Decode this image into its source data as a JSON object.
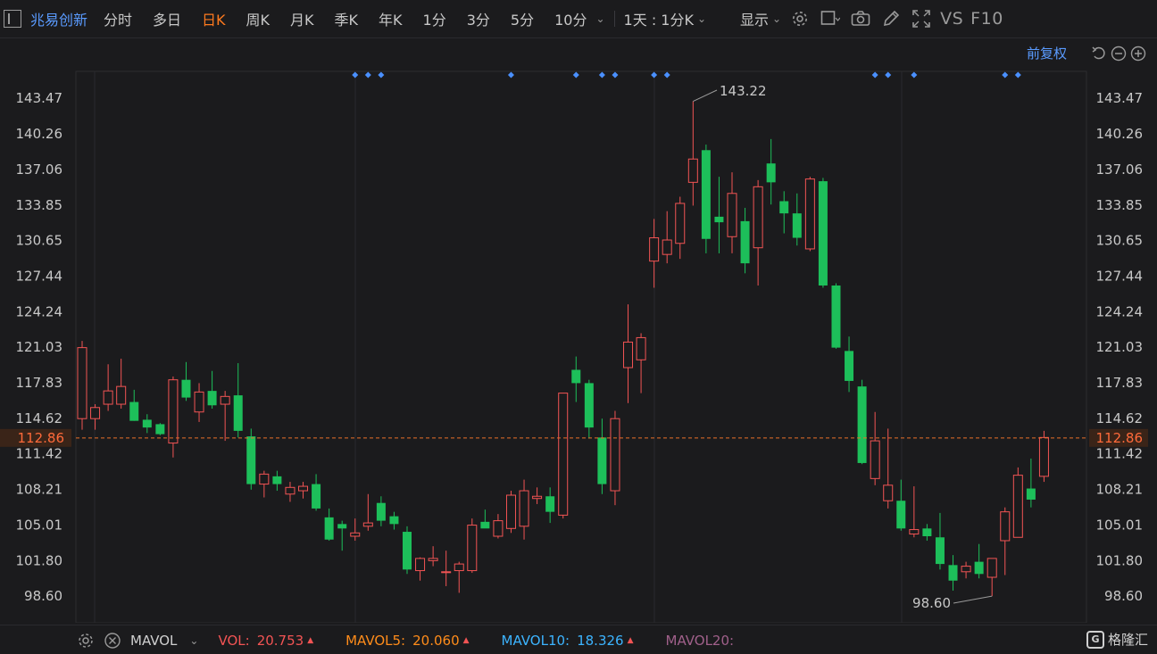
{
  "toolbar": {
    "stock_name": "兆易创新",
    "periods": [
      "分时",
      "多日",
      "日K",
      "周K",
      "月K",
      "季K",
      "年K",
      "1分",
      "3分",
      "5分",
      "10分"
    ],
    "active_period": "日K",
    "multi_period": "1天 : 1分K",
    "display_label": "显示",
    "vs_label": "VS",
    "f10_label": "F10"
  },
  "chart": {
    "restore_label": "前复权",
    "high_label": "143.22",
    "low_label": "98.60",
    "current_price": "112.86",
    "y_ticks": [
      "143.47",
      "140.26",
      "137.06",
      "133.85",
      "130.65",
      "127.44",
      "124.24",
      "121.03",
      "117.83",
      "114.62",
      "111.42",
      "108.21",
      "105.01",
      "101.80",
      "98.60"
    ]
  },
  "chart_data": {
    "type": "candlestick",
    "ylim": [
      96.2,
      145.9
    ],
    "up_color": "#f25454",
    "down_color": "#1dbf5a",
    "candles": [
      {
        "o": 114.6,
        "h": 121.6,
        "l": 113.6,
        "c": 121.0
      },
      {
        "o": 114.6,
        "h": 115.9,
        "l": 113.6,
        "c": 115.6
      },
      {
        "o": 115.9,
        "h": 119.5,
        "l": 115.3,
        "c": 117.1
      },
      {
        "o": 115.9,
        "h": 120.0,
        "l": 115.5,
        "c": 117.5
      },
      {
        "o": 116.1,
        "h": 117.2,
        "l": 114.4,
        "c": 114.4
      },
      {
        "o": 114.5,
        "h": 115.0,
        "l": 113.3,
        "c": 113.8
      },
      {
        "o": 114.1,
        "h": 114.2,
        "l": 113.1,
        "c": 113.2
      },
      {
        "o": 112.4,
        "h": 118.4,
        "l": 111.1,
        "c": 118.1
      },
      {
        "o": 118.1,
        "h": 119.7,
        "l": 116.2,
        "c": 116.5
      },
      {
        "o": 115.2,
        "h": 117.8,
        "l": 114.3,
        "c": 117.0
      },
      {
        "o": 117.1,
        "h": 118.9,
        "l": 115.5,
        "c": 115.8
      },
      {
        "o": 115.9,
        "h": 117.1,
        "l": 112.6,
        "c": 116.6
      },
      {
        "o": 116.7,
        "h": 119.6,
        "l": 112.9,
        "c": 113.5
      },
      {
        "o": 113.0,
        "h": 113.7,
        "l": 108.2,
        "c": 108.7
      },
      {
        "o": 108.7,
        "h": 109.9,
        "l": 107.5,
        "c": 109.6
      },
      {
        "o": 109.4,
        "h": 109.9,
        "l": 108.1,
        "c": 108.7
      },
      {
        "o": 107.8,
        "h": 108.9,
        "l": 107.1,
        "c": 108.4
      },
      {
        "o": 108.1,
        "h": 108.9,
        "l": 107.4,
        "c": 108.5
      },
      {
        "o": 108.7,
        "h": 109.6,
        "l": 106.3,
        "c": 106.5
      },
      {
        "o": 105.7,
        "h": 106.5,
        "l": 103.6,
        "c": 103.7
      },
      {
        "o": 105.1,
        "h": 105.4,
        "l": 102.7,
        "c": 104.7
      },
      {
        "o": 104.0,
        "h": 105.6,
        "l": 103.6,
        "c": 104.3
      },
      {
        "o": 104.9,
        "h": 107.8,
        "l": 104.5,
        "c": 105.2
      },
      {
        "o": 107.0,
        "h": 107.6,
        "l": 104.9,
        "c": 105.4
      },
      {
        "o": 105.8,
        "h": 106.2,
        "l": 104.6,
        "c": 105.1
      },
      {
        "o": 104.4,
        "h": 104.9,
        "l": 100.6,
        "c": 101.0
      },
      {
        "o": 100.9,
        "h": 102.1,
        "l": 100.0,
        "c": 102.0
      },
      {
        "o": 101.8,
        "h": 103.1,
        "l": 101.3,
        "c": 102.0
      },
      {
        "o": 100.8,
        "h": 102.7,
        "l": 99.5,
        "c": 100.8
      },
      {
        "o": 100.9,
        "h": 101.7,
        "l": 98.9,
        "c": 101.5
      },
      {
        "o": 100.9,
        "h": 105.6,
        "l": 100.7,
        "c": 105.0
      },
      {
        "o": 105.3,
        "h": 106.4,
        "l": 104.9,
        "c": 104.7
      },
      {
        "o": 104.0,
        "h": 106.0,
        "l": 103.8,
        "c": 105.4
      },
      {
        "o": 104.7,
        "h": 108.1,
        "l": 104.3,
        "c": 107.7
      },
      {
        "o": 104.9,
        "h": 109.1,
        "l": 103.7,
        "c": 108.1
      },
      {
        "o": 107.4,
        "h": 108.4,
        "l": 106.9,
        "c": 107.6
      },
      {
        "o": 107.6,
        "h": 108.4,
        "l": 105.2,
        "c": 106.2
      },
      {
        "o": 105.9,
        "h": 116.9,
        "l": 105.6,
        "c": 116.9
      },
      {
        "o": 119.0,
        "h": 120.2,
        "l": 116.1,
        "c": 117.8
      },
      {
        "o": 117.8,
        "h": 118.1,
        "l": 112.8,
        "c": 113.8
      },
      {
        "o": 112.9,
        "h": 114.6,
        "l": 107.8,
        "c": 108.7
      },
      {
        "o": 108.1,
        "h": 115.3,
        "l": 106.8,
        "c": 114.6
      },
      {
        "o": 119.2,
        "h": 124.9,
        "l": 116.0,
        "c": 121.5
      },
      {
        "o": 119.9,
        "h": 122.3,
        "l": 116.9,
        "c": 121.9
      },
      {
        "o": 128.8,
        "h": 132.6,
        "l": 126.4,
        "c": 130.9
      },
      {
        "o": 129.4,
        "h": 133.3,
        "l": 128.6,
        "c": 130.7
      },
      {
        "o": 130.4,
        "h": 134.6,
        "l": 129.0,
        "c": 134.0
      },
      {
        "o": 135.9,
        "h": 143.2,
        "l": 133.8,
        "c": 138.0
      },
      {
        "o": 138.8,
        "h": 139.3,
        "l": 129.5,
        "c": 130.8
      },
      {
        "o": 132.8,
        "h": 136.4,
        "l": 129.5,
        "c": 132.3
      },
      {
        "o": 131.0,
        "h": 136.8,
        "l": 129.5,
        "c": 134.9
      },
      {
        "o": 132.4,
        "h": 133.6,
        "l": 127.7,
        "c": 128.6
      },
      {
        "o": 130.0,
        "h": 136.1,
        "l": 126.6,
        "c": 135.5
      },
      {
        "o": 137.6,
        "h": 139.8,
        "l": 133.9,
        "c": 135.9
      },
      {
        "o": 134.2,
        "h": 135.1,
        "l": 131.3,
        "c": 133.1
      },
      {
        "o": 133.1,
        "h": 134.9,
        "l": 130.2,
        "c": 130.9
      },
      {
        "o": 129.9,
        "h": 136.4,
        "l": 129.7,
        "c": 136.2
      },
      {
        "o": 136.0,
        "h": 136.3,
        "l": 126.4,
        "c": 126.6
      },
      {
        "o": 126.6,
        "h": 126.8,
        "l": 120.9,
        "c": 121.0
      },
      {
        "o": 120.7,
        "h": 122.0,
        "l": 117.0,
        "c": 118.0
      },
      {
        "o": 117.5,
        "h": 118.1,
        "l": 110.5,
        "c": 110.6
      },
      {
        "o": 109.2,
        "h": 115.2,
        "l": 108.6,
        "c": 112.6
      },
      {
        "o": 107.2,
        "h": 113.7,
        "l": 106.5,
        "c": 108.6
      },
      {
        "o": 107.2,
        "h": 109.1,
        "l": 104.5,
        "c": 104.7
      },
      {
        "o": 104.2,
        "h": 108.5,
        "l": 103.9,
        "c": 104.6
      },
      {
        "o": 104.7,
        "h": 105.1,
        "l": 103.6,
        "c": 104.0
      },
      {
        "o": 103.9,
        "h": 106.1,
        "l": 101.0,
        "c": 101.5
      },
      {
        "o": 101.4,
        "h": 102.3,
        "l": 99.1,
        "c": 100.0
      },
      {
        "o": 100.8,
        "h": 101.7,
        "l": 100.2,
        "c": 101.3
      },
      {
        "o": 101.7,
        "h": 103.3,
        "l": 100.2,
        "c": 100.6
      },
      {
        "o": 100.3,
        "h": 102.0,
        "l": 98.6,
        "c": 102.0
      },
      {
        "o": 103.6,
        "h": 106.6,
        "l": 100.5,
        "c": 106.2
      },
      {
        "o": 103.9,
        "h": 110.2,
        "l": 103.9,
        "c": 109.5
      },
      {
        "o": 108.3,
        "h": 111.0,
        "l": 106.6,
        "c": 107.3
      },
      {
        "o": 109.4,
        "h": 113.5,
        "l": 108.9,
        "c": 112.9
      }
    ]
  },
  "markers": {
    "candle_indices": [
      21,
      22,
      23,
      33,
      38,
      40,
      41,
      44,
      45,
      61,
      62,
      64,
      71,
      72
    ]
  },
  "volume_bar": {
    "indicator": "MAVOL",
    "vol_label": "VOL:",
    "vol_value": "20.753",
    "mavol5_label": "MAVOL5:",
    "mavol5_value": "20.060",
    "mavol10_label": "MAVOL10:",
    "mavol10_value": "18.326",
    "mavol20_label": "MAVOL20:",
    "colors": {
      "vol": "#f25454",
      "mavol5": "#ff8c1a",
      "mavol10": "#3cb4ff",
      "mavol20": "#a0608a"
    }
  },
  "brand": {
    "logo_text": "G",
    "name": "格隆汇"
  }
}
